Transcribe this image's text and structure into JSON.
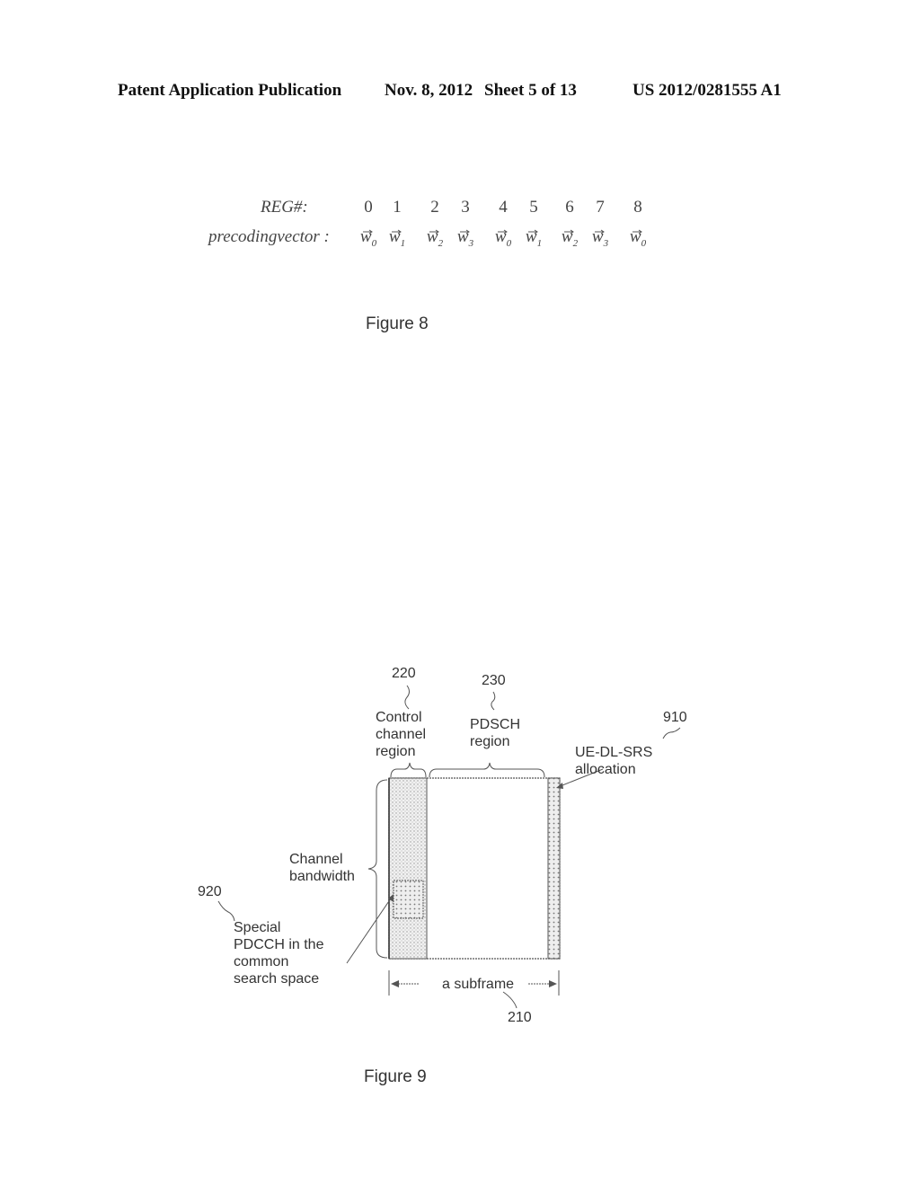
{
  "header": {
    "publication": "Patent Application Publication",
    "date": "Nov. 8, 2012",
    "sheet": "Sheet 5 of 13",
    "number": "US 2012/0281555 A1"
  },
  "figure8": {
    "caption": "Figure 8",
    "reg_label": "REG#:",
    "vector_label": "precodingvector :",
    "reg_numbers": [
      "0",
      "1",
      "2",
      "3",
      "4",
      "5",
      "6",
      "7",
      "8"
    ],
    "vectors": [
      {
        "symbol": "w",
        "sub": "0"
      },
      {
        "symbol": "w",
        "sub": "1"
      },
      {
        "symbol": "w",
        "sub": "2"
      },
      {
        "symbol": "w",
        "sub": "3"
      },
      {
        "symbol": "w",
        "sub": "0"
      },
      {
        "symbol": "w",
        "sub": "1"
      },
      {
        "symbol": "w",
        "sub": "2"
      },
      {
        "symbol": "w",
        "sub": "3"
      },
      {
        "symbol": "w",
        "sub": "0"
      }
    ]
  },
  "figure9": {
    "caption": "Figure 9",
    "ref_220": "220",
    "control_label": [
      "Control",
      "channel",
      "region"
    ],
    "ref_230": "230",
    "pdsch_label": [
      "PDSCH",
      "region"
    ],
    "ref_910": "910",
    "srs_label": [
      "UE-DL-SRS",
      "allocation"
    ],
    "bandwidth_label": [
      "Channel",
      "bandwidth"
    ],
    "ref_920": "920",
    "special_label": [
      "Special",
      "PDCCH in the",
      "common",
      "search space"
    ],
    "subframe_label": "a subframe",
    "ref_210": "210"
  }
}
